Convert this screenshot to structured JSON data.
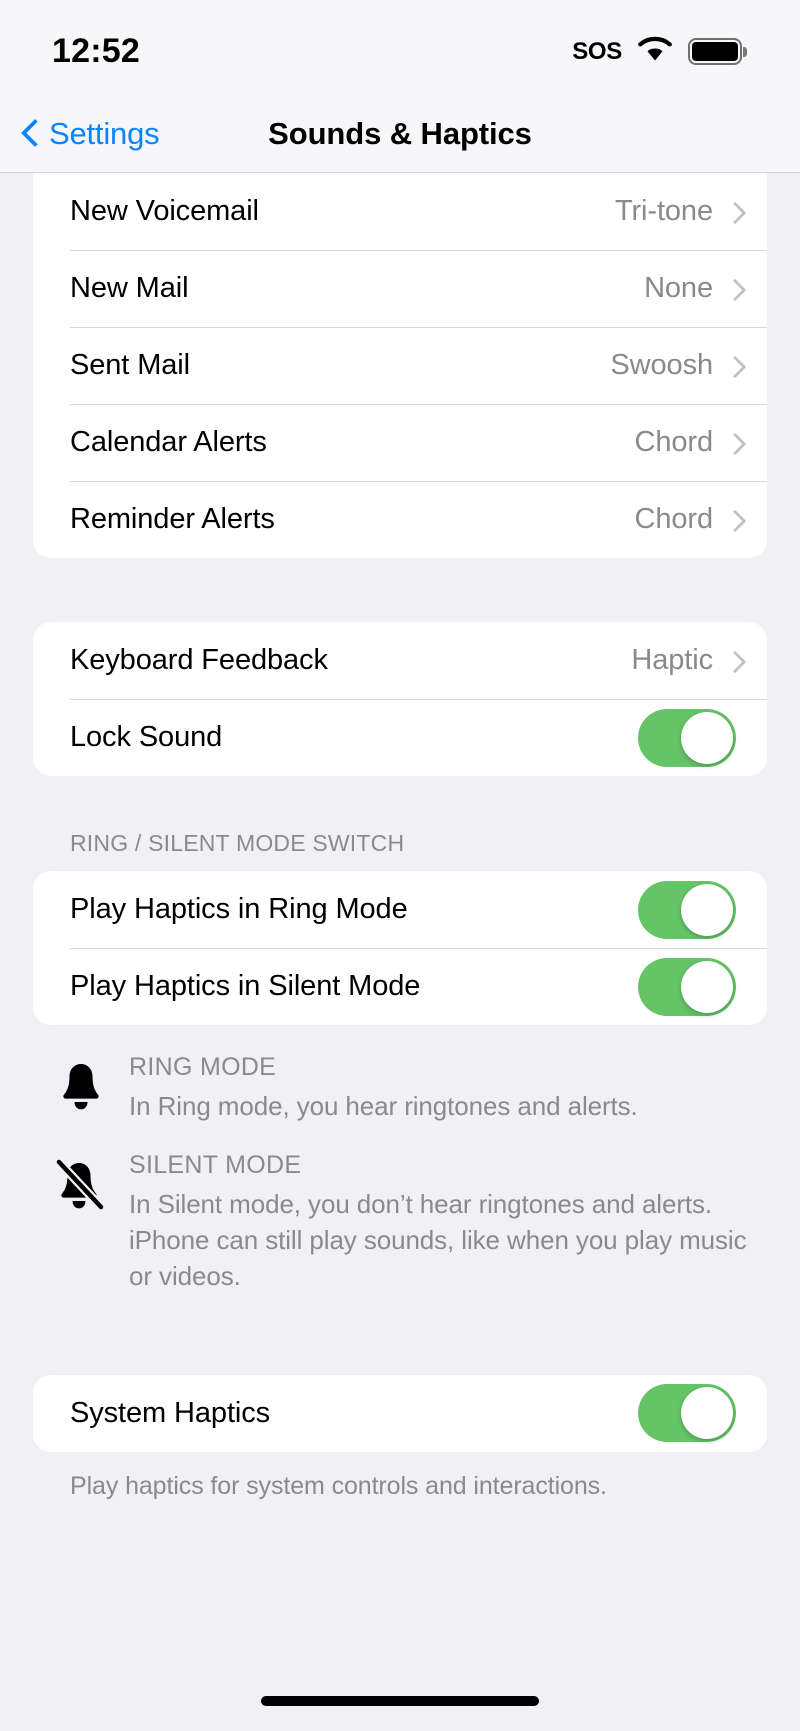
{
  "status_bar": {
    "time": "12:52",
    "sos_label": "SOS",
    "wifi_icon": "wifi-icon",
    "battery_icon": "battery-full-icon"
  },
  "nav_bar": {
    "back_label": "Settings",
    "back_icon": "chevron-left-icon",
    "title": "Sounds & Haptics"
  },
  "colors": {
    "toggle_on": "#64C466",
    "accent_blue": "#0A84FF",
    "page_background": "#F1F1F5",
    "card_background": "#FFFFFF",
    "secondary_text": "#8A8A8E"
  },
  "sections": [
    {
      "id": "sounds-group",
      "header": "",
      "footer": "",
      "rows": [
        {
          "label": "New Voicemail",
          "value": "Tri-tone",
          "type": "disclosure"
        },
        {
          "label": "New Mail",
          "value": "None",
          "type": "disclosure"
        },
        {
          "label": "Sent Mail",
          "value": "Swoosh",
          "type": "disclosure"
        },
        {
          "label": "Calendar Alerts",
          "value": "Chord",
          "type": "disclosure"
        },
        {
          "label": "Reminder Alerts",
          "value": "Chord",
          "type": "disclosure"
        }
      ]
    },
    {
      "id": "keyboard-lock-group",
      "header": "",
      "footer": "",
      "rows": [
        {
          "label": "Keyboard Feedback",
          "value": "Haptic",
          "type": "disclosure"
        },
        {
          "label": "Lock Sound",
          "value": "on",
          "type": "toggle"
        }
      ]
    },
    {
      "id": "ring-silent-group",
      "header": "RING / SILENT MODE SWITCH",
      "footer": "",
      "rows": [
        {
          "label": "Play Haptics in Ring Mode",
          "value": "on",
          "type": "toggle"
        },
        {
          "label": "Play Haptics in Silent Mode",
          "value": "on",
          "type": "toggle"
        }
      ]
    },
    {
      "id": "system-haptics-group",
      "header": "",
      "footer": "Play haptics for system controls and interactions.",
      "rows": [
        {
          "label": "System Haptics",
          "value": "on",
          "type": "toggle"
        }
      ]
    }
  ],
  "modes": [
    {
      "icon": "bell-icon",
      "title": "RING MODE",
      "description": "In Ring mode, you hear ringtones and alerts."
    },
    {
      "icon": "bell-slash-icon",
      "title": "SILENT MODE",
      "description": "In Silent mode, you don’t hear ringtones and alerts. iPhone can still play sounds, like when you play music or videos."
    }
  ]
}
